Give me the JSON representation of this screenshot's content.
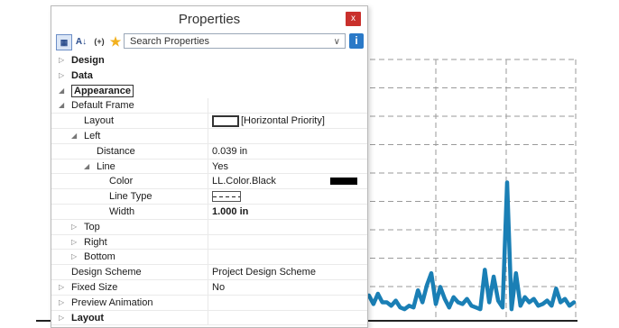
{
  "window": {
    "title": "Properties",
    "close_label": "x"
  },
  "toolbar": {
    "search_placeholder": "Search Properties",
    "formula_label": "(+)",
    "info_label": "i"
  },
  "properties": [
    {
      "name": "Design",
      "value": "",
      "indent": 0,
      "toggle": "collapsed",
      "bold": true
    },
    {
      "name": "Data",
      "value": "",
      "indent": 0,
      "toggle": "collapsed",
      "bold": true
    },
    {
      "name": "Appearance",
      "value": "",
      "indent": 0,
      "toggle": "expanded",
      "bold": true
    },
    {
      "name": "Default Frame",
      "value": "",
      "indent": 1,
      "toggle": "expanded",
      "bold": false
    },
    {
      "name": "Layout",
      "value": "[Horizontal Priority]",
      "indent": 2,
      "toggle": "none",
      "bold": false
    },
    {
      "name": "Left",
      "value": "",
      "indent": 2,
      "toggle": "expanded",
      "bold": false
    },
    {
      "name": "Distance",
      "value": "0.039 in",
      "indent": 3,
      "toggle": "none",
      "bold": false
    },
    {
      "name": "Line",
      "value": "Yes",
      "indent": 3,
      "toggle": "expanded",
      "bold": false
    },
    {
      "name": "Color",
      "value": "LL.Color.Black",
      "indent": 4,
      "toggle": "none",
      "bold": false
    },
    {
      "name": "Line Type",
      "value": "",
      "indent": 4,
      "toggle": "none",
      "bold": false
    },
    {
      "name": "Width",
      "value": "1.000 in",
      "indent": 4,
      "toggle": "none",
      "bold": false
    },
    {
      "name": "Top",
      "value": "",
      "indent": 2,
      "toggle": "collapsed",
      "bold": false
    },
    {
      "name": "Right",
      "value": "",
      "indent": 2,
      "toggle": "collapsed",
      "bold": false
    },
    {
      "name": "Bottom",
      "value": "",
      "indent": 2,
      "toggle": "collapsed",
      "bold": false
    },
    {
      "name": "Design Scheme",
      "value": "Project Design Scheme",
      "indent": 1,
      "toggle": "none",
      "bold": false
    },
    {
      "name": "Fixed Size",
      "value": "No",
      "indent": 1,
      "toggle": "collapsed",
      "bold": false
    },
    {
      "name": "Preview Animation",
      "value": "",
      "indent": 1,
      "toggle": "collapsed",
      "bold": false
    },
    {
      "name": "Layout",
      "value": "",
      "indent": 1,
      "toggle": "collapsed",
      "bold": true
    }
  ],
  "colors": {
    "accent": "#1a7fb5",
    "close": "#c9302c",
    "info": "#2a79c7",
    "star": "#f2b01e"
  },
  "chart_data": {
    "type": "line",
    "series_values": [
      8,
      9,
      4,
      10,
      5,
      5,
      3,
      6,
      2,
      1,
      3,
      2,
      12,
      5,
      15,
      22,
      4,
      14,
      7,
      2,
      8,
      5,
      4,
      7,
      3,
      2,
      1,
      24,
      5,
      20,
      6,
      2,
      75,
      1,
      22,
      3,
      8,
      5,
      7,
      3,
      4,
      6,
      3,
      13,
      5,
      7,
      3,
      5
    ]
  }
}
